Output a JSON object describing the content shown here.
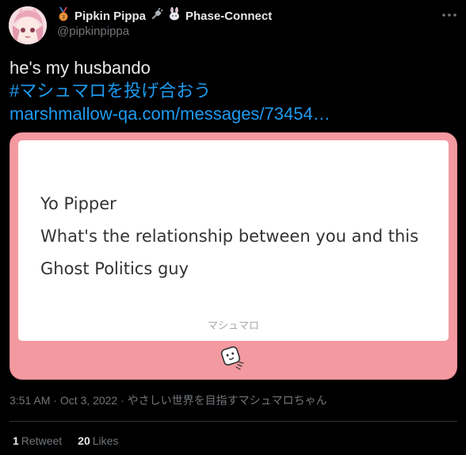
{
  "author": {
    "display_name": "Pipkin Pippa",
    "badge_icon": "bronze-medal-icon",
    "org_icons": [
      "plug-icon",
      "rabbit-icon"
    ],
    "org_name": "Phase-Connect",
    "handle": "@pipkinpippa"
  },
  "tweet": {
    "line1": "he's my husbando",
    "hashtag": "#マシュマロを投げ合おう",
    "link_text": "marshmallow-qa.com/messages/73454…"
  },
  "card": {
    "message_lines": [
      "Yo Pipper",
      "What's the relationship between you and this",
      "Ghost Politics guy"
    ],
    "footer_label": "マシュマロ",
    "background_color": "#f39aa0",
    "logo_icon": "marshmallow-logo-icon"
  },
  "meta": {
    "time": "3:51 AM",
    "date": "Oct 3, 2022",
    "source": "やさしい世界を目指すマシュマロちゃん",
    "separator": " · "
  },
  "stats": {
    "retweets_count": "1",
    "retweets_label": "Retweet",
    "likes_count": "20",
    "likes_label": "Likes"
  },
  "colors": {
    "background": "#000000",
    "link": "#1d9bf0",
    "text": "#e7e9ea",
    "muted": "#71767b"
  }
}
